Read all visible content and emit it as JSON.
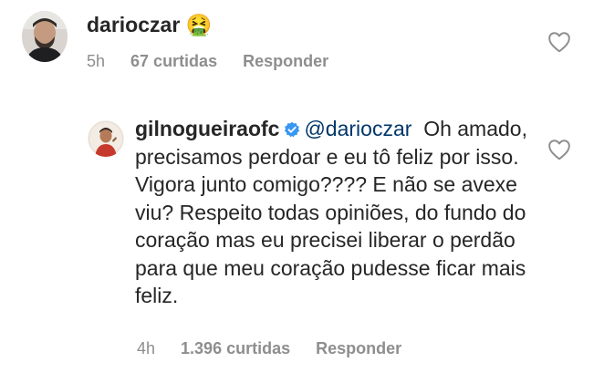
{
  "comments": [
    {
      "username": "darioczar",
      "emoji": "🤮",
      "time": "5h",
      "likes": "67 curtidas",
      "reply_label": "Responder",
      "icons": {
        "avatar": "avatar-photo",
        "like": "heart-outline-icon"
      }
    },
    {
      "username": "gilnogueiraofc",
      "verified": true,
      "mention": "@darioczar",
      "text": "Oh amado, precisamos perdoar e eu tô feliz por isso. Vigora junto comigo???? E não se avexe viu? Respeito todas opiniões, do fundo do coração mas eu precisei liberar o perdão para que meu coração pudesse ficar mais feliz.",
      "time": "4h",
      "likes": "1.396 curtidas",
      "reply_label": "Responder",
      "icons": {
        "avatar": "avatar-photo",
        "verified": "verified-badge-icon",
        "like": "heart-outline-icon"
      }
    }
  ],
  "colors": {
    "text": "#262626",
    "meta": "#8e8e8e",
    "mention": "#00376b",
    "verified": "#3897f0"
  }
}
